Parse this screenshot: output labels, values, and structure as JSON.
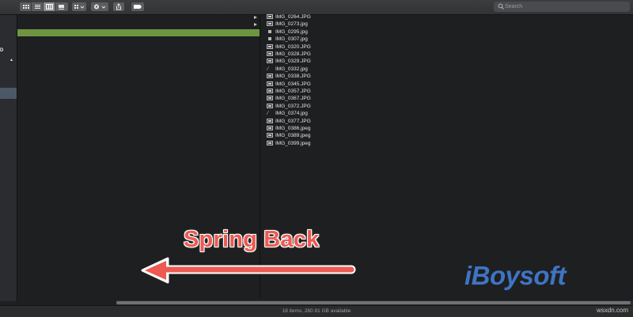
{
  "toolbar": {
    "view_modes": [
      "icon-view",
      "list-view",
      "column-view",
      "gallery-view"
    ],
    "selected_view": "column-view",
    "group_button": "group-by-grid-icon",
    "action_button": "gear-icon",
    "share_button": "share-icon",
    "tag_button": "tag-icon"
  },
  "search": {
    "placeholder": "Search"
  },
  "sidebar": {
    "items": [
      {
        "label": "D"
      },
      {
        "label": "▲"
      }
    ]
  },
  "column1": {
    "selected_row_color": "#6e9440"
  },
  "files": [
    {
      "name": "IMG_0264.JPG",
      "icon": "image-thumbnail-icon"
    },
    {
      "name": "IMG_0273.jpg",
      "icon": "image-thumbnail-icon"
    },
    {
      "name": "IMG_0295.jpg",
      "icon": "image-small-icon"
    },
    {
      "name": "IMG_0307.jpg",
      "icon": "image-small-icon"
    },
    {
      "name": "IMG_0320.JPG",
      "icon": "image-thumbnail-icon"
    },
    {
      "name": "IMG_0328.JPG",
      "icon": "image-thumbnail-icon"
    },
    {
      "name": "IMG_0329.JPG",
      "icon": "image-thumbnail-icon"
    },
    {
      "name": "IMG_0332.jpg",
      "icon": "image-glyph-icon"
    },
    {
      "name": "IMG_0338.JPG",
      "icon": "image-thumbnail-icon"
    },
    {
      "name": "IMG_0345.JPG",
      "icon": "image-thumbnail-icon"
    },
    {
      "name": "IMG_0357.JPG",
      "icon": "image-thumbnail-icon"
    },
    {
      "name": "IMG_0367.JPG",
      "icon": "image-thumbnail-icon"
    },
    {
      "name": "IMG_0372.JPG",
      "icon": "image-thumbnail-icon"
    },
    {
      "name": "IMG_0374.jpg",
      "icon": "image-glyph-icon"
    },
    {
      "name": "IMG_0377.JPG",
      "icon": "image-thumbnail-icon"
    },
    {
      "name": "IMG_0386.jpeg",
      "icon": "image-thumbnail-icon"
    },
    {
      "name": "IMG_0389.jpeg",
      "icon": "image-thumbnail-icon"
    },
    {
      "name": "IMG_0399.jpeg",
      "icon": "image-thumbnail-icon"
    }
  ],
  "status": {
    "text": "18 items, 280.91 GB available"
  },
  "annotation": {
    "label": "Spring Back",
    "arrow_direction": "left",
    "color": "#ec5a52"
  },
  "watermark": {
    "logo": "iBoysoft",
    "logo_color": "#3f74c4",
    "site": "wsxdn.com"
  }
}
